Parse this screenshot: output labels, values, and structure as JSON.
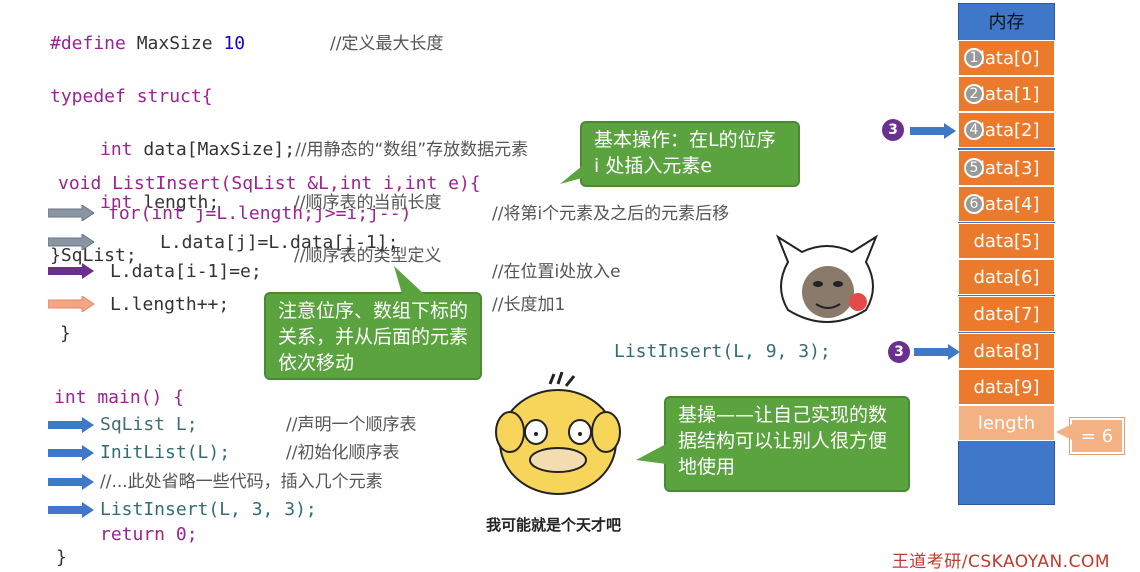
{
  "code_struct": {
    "line1": {
      "kw": "#define",
      "rest": " MaxSize ",
      "num": "10",
      "comment": "//定义最大长度"
    },
    "line2": "typedef struct{",
    "line3": {
      "ty": "int",
      "rest": " data[MaxSize];",
      "comment": "//用静态的“数组”存放数据元素"
    },
    "line4": {
      "ty": "int",
      "rest": " length;",
      "comment": "//顺序表的当前长度"
    },
    "line5": {
      "rest": "}SqList;",
      "comment": "//顺序表的类型定义"
    }
  },
  "code_insert": {
    "sig": "void ListInsert(SqList &L,int i,int e){",
    "for": "for(int j=L.length;j>=i;j--)",
    "for_comment": "//将第i个元素及之后的元素后移",
    "shift": "L.data[j]=L.data[j-1];",
    "assign": "L.data[i-1]=e;",
    "assign_comment": "//在位置i处放入e",
    "inc": "L.length++;",
    "inc_comment": "//长度加1",
    "close": "}"
  },
  "code_main": {
    "sig": "int main() {",
    "l1": "SqList L;",
    "l1_comment": "//声明一个顺序表",
    "l2": "InitList(L);",
    "l2_comment": "//初始化顺序表",
    "l3": "//...此处省略一些代码，插入几个元素",
    "l4": "ListInsert(L, 3, 3);",
    "l5": "return 0;",
    "close": "}"
  },
  "call_example": "ListInsert(L, 9, 3);",
  "callouts": {
    "basic_op": "基本操作：在L的位序 i 处插入元素e",
    "note": "注意位序、数组下标的关系，并从后面的元素依次移动",
    "jicao": "基操——让自己实现的数据结构可以让别人很方便地使用"
  },
  "caption_duck": "我可能就是个天才吧",
  "memory": {
    "title": "内存",
    "cells": [
      "data[0]",
      "data[1]",
      "data[2]",
      "data[3]",
      "data[4]",
      "data[5]",
      "data[6]",
      "data[7]",
      "data[8]",
      "data[9]"
    ],
    "length_label": "length",
    "length_value": "= 6",
    "circle_numbers": [
      "1",
      "2",
      "4",
      "5",
      "6"
    ]
  },
  "markers": {
    "three": "3"
  },
  "footer": "王道考研/CSKAOYAN.COM",
  "colors": {
    "orange": "#ec7a2c",
    "blue": "#3f78c9",
    "green": "#5aa33f",
    "purple": "#6b2f8f"
  }
}
